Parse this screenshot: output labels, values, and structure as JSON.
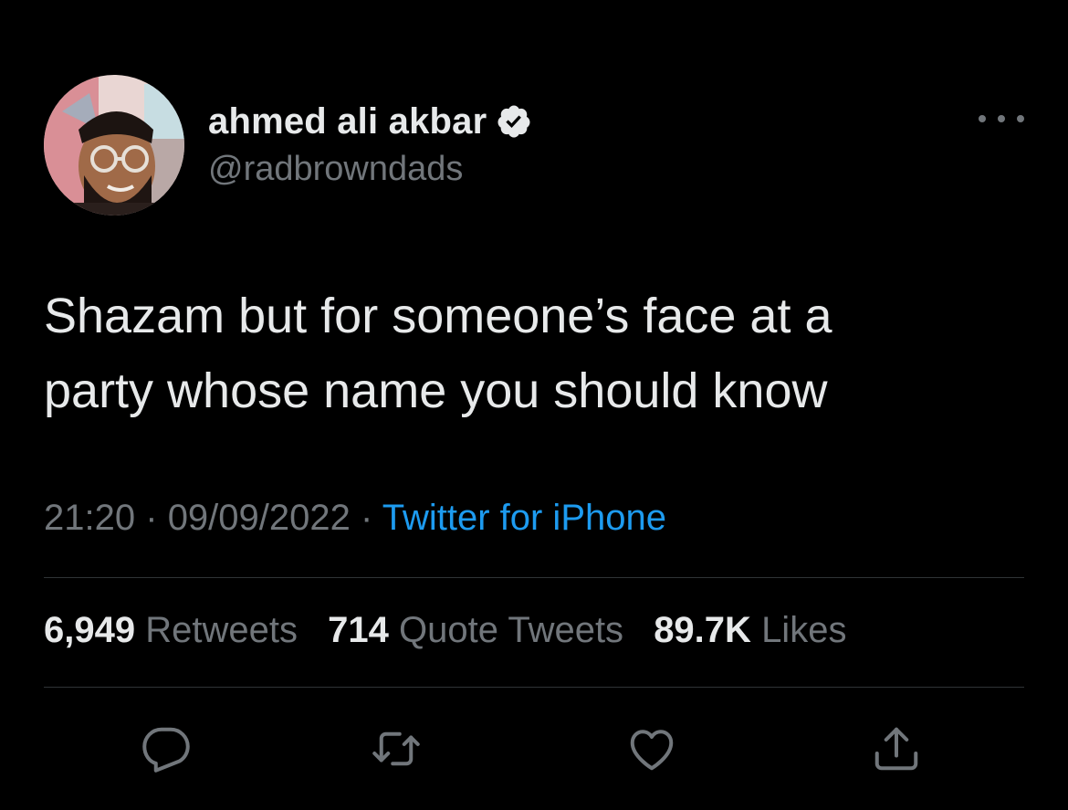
{
  "tweet": {
    "author": {
      "display_name": "ahmed ali akbar",
      "handle": "@radbrowndads",
      "verified": true,
      "avatar_icon": "profile-photo"
    },
    "more_icon": "more-horizontal-icon",
    "text_line1": "Shazam but for someone’s face at a",
    "text_line2": "party whose name you should know",
    "time": "21:20",
    "separator": "·",
    "date": "09/09/2022",
    "source": "Twitter for iPhone",
    "stats": {
      "retweets_count": "6,949",
      "retweets_label": "Retweets",
      "quotes_count": "714",
      "quotes_label": "Quote Tweets",
      "likes_count": "89.7K",
      "likes_label": "Likes"
    },
    "actions": [
      {
        "name": "reply",
        "icon": "reply-icon"
      },
      {
        "name": "retweet",
        "icon": "retweet-icon"
      },
      {
        "name": "like",
        "icon": "heart-icon"
      },
      {
        "name": "share",
        "icon": "share-icon"
      }
    ]
  },
  "colors": {
    "background": "#000000",
    "primary_text": "#e7e9ea",
    "secondary_text": "#71767b",
    "link": "#1d9bf0",
    "divider": "#2f3336"
  }
}
